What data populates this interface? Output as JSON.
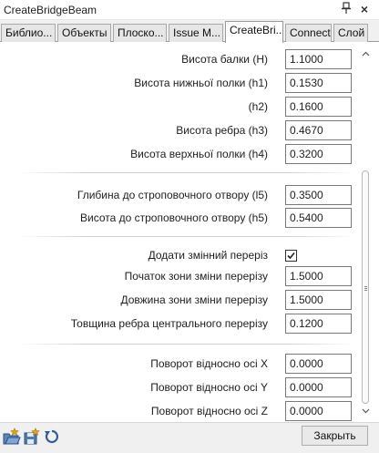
{
  "window": {
    "title": "CreateBridgeBeam",
    "pin_glyph": "ᵖ",
    "close_glyph": "×"
  },
  "tabs": [
    {
      "label": "Библио...",
      "active": false
    },
    {
      "label": "Объекты",
      "active": false
    },
    {
      "label": "Плоско...",
      "active": false
    },
    {
      "label": "Issue M...",
      "active": false
    },
    {
      "label": "CreateBri...",
      "active": true
    },
    {
      "label": "Connect",
      "active": false
    },
    {
      "label": "Слой",
      "active": false
    }
  ],
  "fields": {
    "beam_height": {
      "label": "Висота балки (H)",
      "value": "1.1000"
    },
    "bottom_flange_height": {
      "label": "Висота нижньої полки (h1)",
      "value": "0.1530"
    },
    "h2": {
      "label": "(h2)",
      "value": "0.1600"
    },
    "rib_height": {
      "label": "Висота ребра (h3)",
      "value": "0.4670"
    },
    "top_flange_height": {
      "label": "Висота верхньої полки (h4)",
      "value": "0.3200"
    },
    "sling_hole_depth": {
      "label": "Глибина до строповочного отвору (l5)",
      "value": "0.3500"
    },
    "sling_hole_height": {
      "label": "Висота до строповочного отвору (h5)",
      "value": "0.5400"
    },
    "variable_section": {
      "label": "Додати змінний переріз",
      "checked": true
    },
    "change_zone_start": {
      "label": "Початок зони зміни перерізу",
      "value": "1.5000"
    },
    "change_zone_length": {
      "label": "Довжина зони зміни перерізу",
      "value": "1.5000"
    },
    "central_rib_thickness": {
      "label": "Товщина ребра центрального перерізу",
      "value": "0.1200"
    },
    "rotation_x": {
      "label": "Поворот відносно осі X",
      "value": "0.0000"
    },
    "rotation_y": {
      "label": "Поворот відносно осі Y",
      "value": "0.0000"
    },
    "rotation_z": {
      "label": "Поворот відносно осі Z",
      "value": "0.0000"
    }
  },
  "bottom": {
    "close_label": "Закрыть",
    "icons": [
      "open-favorite-icon",
      "save-favorite-icon",
      "reset-icon"
    ]
  },
  "colors": {
    "accent_blue": "#2a6fc4",
    "tab_active_bg": "#ffffff",
    "tab_inactive_bg": "#e6e6e6"
  }
}
